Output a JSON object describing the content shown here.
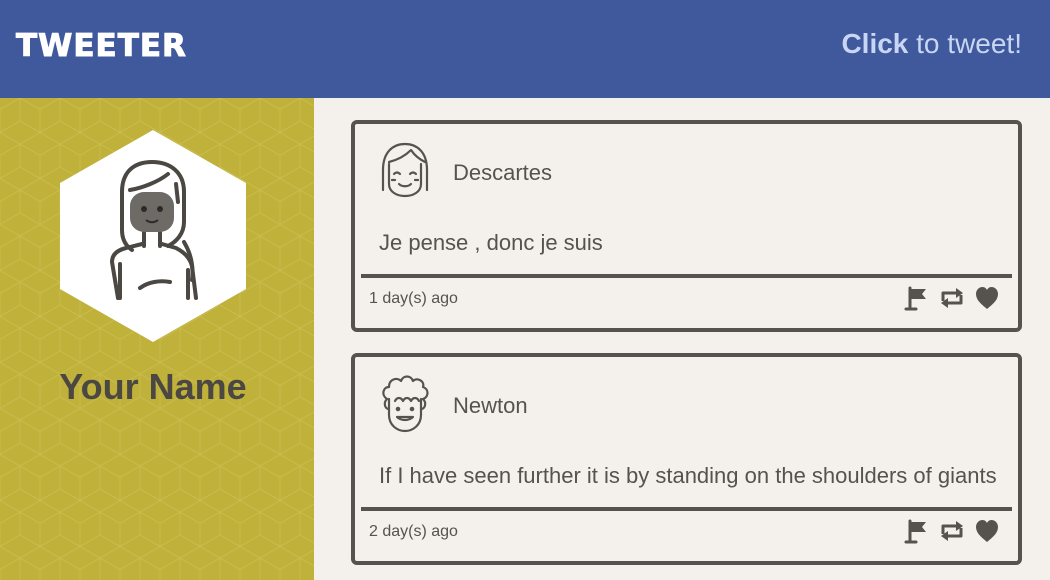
{
  "header": {
    "brand": "TWEETER",
    "compose_click": "Click",
    "compose_rest": " to tweet!"
  },
  "profile": {
    "name": "Your Name"
  },
  "tweets": [
    {
      "author": "Descartes",
      "text": "Je pense , donc je suis",
      "time": "1 day(s) ago",
      "avatar_icon": "smiling-face-bangs-icon"
    },
    {
      "author": "Newton",
      "text": "If I have seen further it is by standing on the shoulders of giants",
      "time": "2 day(s) ago",
      "avatar_icon": "curly-hair-face-icon"
    }
  ],
  "actions": [
    "flag-icon",
    "retweet-icon",
    "heart-icon"
  ],
  "colors": {
    "header": "#3f599c",
    "sidebar": "#bfb13a",
    "background": "#f4f1ec",
    "ink": "#56524d",
    "compose_text": "#c8d6f4"
  }
}
